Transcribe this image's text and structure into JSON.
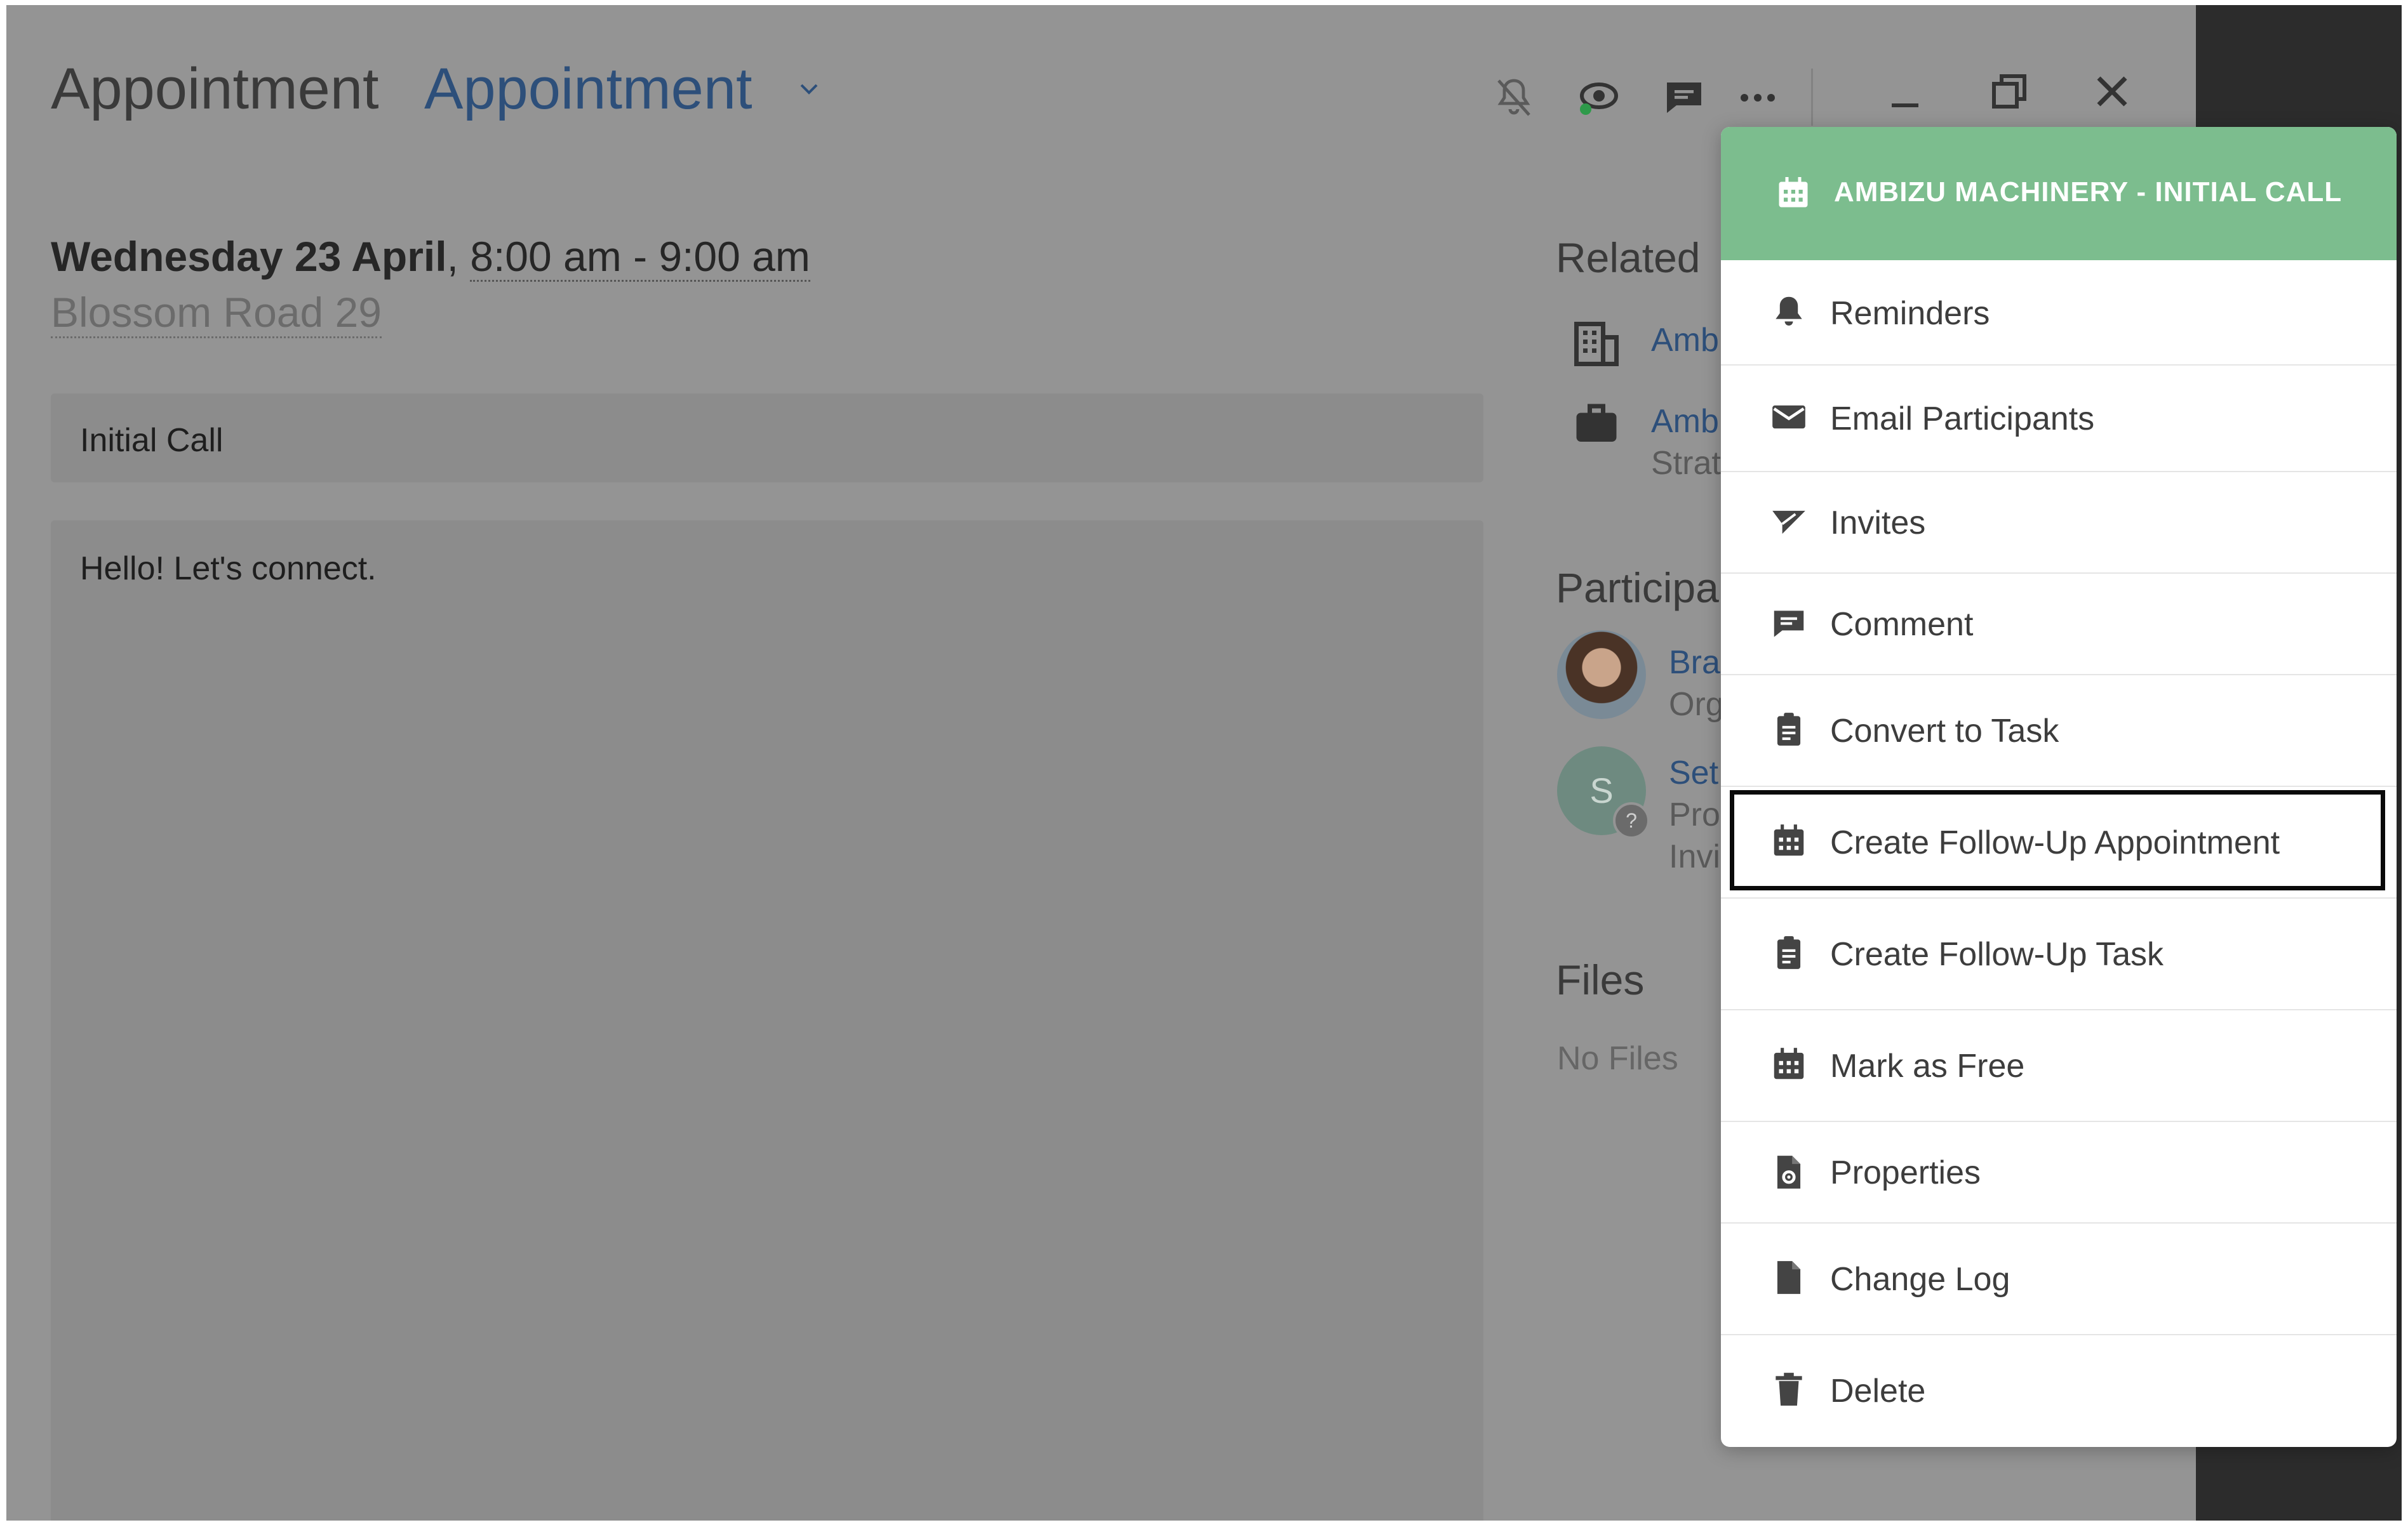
{
  "header": {
    "entity_type": "Appointment",
    "view_selector": "Appointment"
  },
  "appointment": {
    "day": "Wednesday 23 April",
    "separator": ",",
    "time": "8:00 am - 9:00 am",
    "location": "Blossom Road 29",
    "subject": "Initial Call",
    "notes": "Hello! Let's connect."
  },
  "side": {
    "related_title": "Related",
    "related_items": [
      {
        "label": "Ambi",
        "sub": ""
      },
      {
        "label": "Ambi",
        "sub": "Strat"
      }
    ],
    "participants_title": "Participa",
    "participants": [
      {
        "name": "Bra",
        "role": "Org",
        "extra": ""
      },
      {
        "initial": "S",
        "badge": "?",
        "name": "Set",
        "role": "Pro",
        "extra": "Invi"
      }
    ],
    "files_title": "Files",
    "files_empty": "No Files"
  },
  "menu": {
    "title": "AMBIZU MACHINERY - INITIAL CALL",
    "items": [
      {
        "label": "Reminders",
        "icon": "bell-icon"
      },
      {
        "label": "Email Participants",
        "icon": "envelope-icon"
      },
      {
        "label": "Invites",
        "icon": "paper-plane-icon"
      },
      {
        "label": "Comment",
        "icon": "comment-icon"
      },
      {
        "label": "Convert to Task",
        "icon": "clipboard-icon"
      },
      {
        "label": "Create Follow-Up Appointment",
        "icon": "calendar-icon"
      },
      {
        "label": "Create Follow-Up Task",
        "icon": "clipboard-icon"
      },
      {
        "label": "Mark as Free",
        "icon": "calendar-icon"
      },
      {
        "label": "Properties",
        "icon": "file-gear-icon"
      },
      {
        "label": "Change Log",
        "icon": "file-icon"
      },
      {
        "label": "Delete",
        "icon": "trash-icon"
      }
    ]
  },
  "colors": {
    "accent_green": "#7cbd8e",
    "link_blue": "#2d4f7a",
    "overlay_grey": "#949494"
  }
}
